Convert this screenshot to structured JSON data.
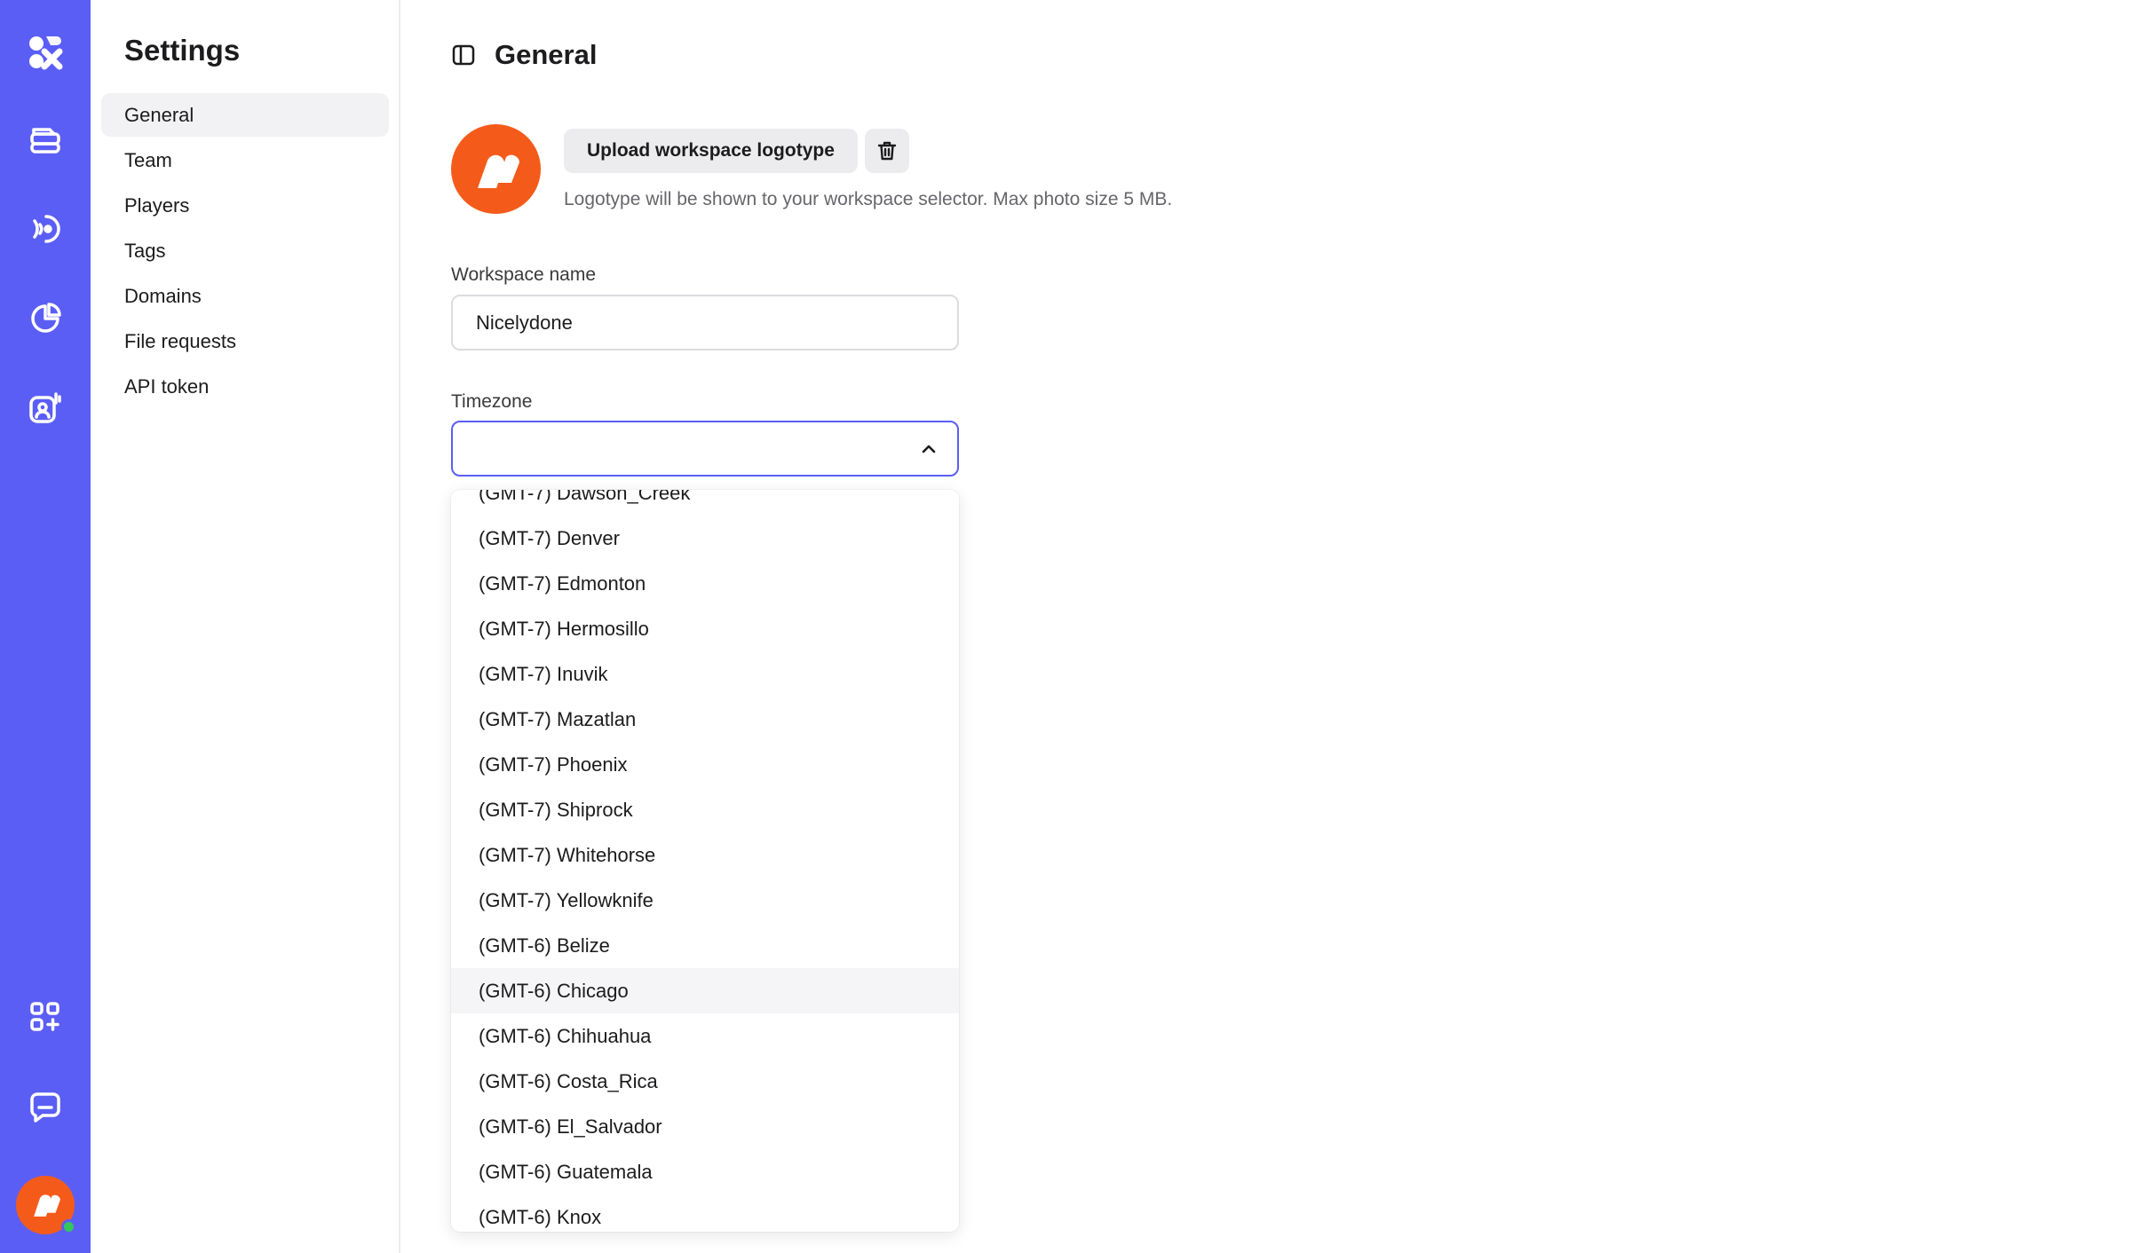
{
  "settings_nav": {
    "title": "Settings",
    "items": [
      {
        "label": "General",
        "active": true
      },
      {
        "label": "Team"
      },
      {
        "label": "Players"
      },
      {
        "label": "Tags"
      },
      {
        "label": "Domains"
      },
      {
        "label": "File requests"
      },
      {
        "label": "API token"
      }
    ]
  },
  "header": {
    "title": "General"
  },
  "logo_section": {
    "upload_label": "Upload workspace logotype",
    "help_text": "Logotype will be shown to your workspace selector. Max photo size 5 MB."
  },
  "workspace_name": {
    "label": "Workspace name",
    "value": "Nicelydone"
  },
  "timezone": {
    "label": "Timezone",
    "value": "",
    "options": [
      "(GMT-7) Dawson_Creek",
      "(GMT-7) Denver",
      "(GMT-7) Edmonton",
      "(GMT-7) Hermosillo",
      "(GMT-7) Inuvik",
      "(GMT-7) Mazatlan",
      "(GMT-7) Phoenix",
      "(GMT-7) Shiprock",
      "(GMT-7) Whitehorse",
      "(GMT-7) Yellowknife",
      "(GMT-6) Belize",
      "(GMT-6) Chicago",
      "(GMT-6) Chihuahua",
      "(GMT-6) Costa_Rica",
      "(GMT-6) El_Salvador",
      "(GMT-6) Guatemala",
      "(GMT-6) Knox"
    ],
    "hovered_option": "(GMT-6) Chicago"
  },
  "rail_icons": [
    "app-logo-icon",
    "media-library-icon",
    "broadcast-icon",
    "analytics-icon",
    "customer-support-icon",
    "integrations-icon",
    "chat-icon"
  ],
  "colors": {
    "accent": "#5b5ef5",
    "brand": "#f45b1a",
    "online": "#34c759"
  }
}
